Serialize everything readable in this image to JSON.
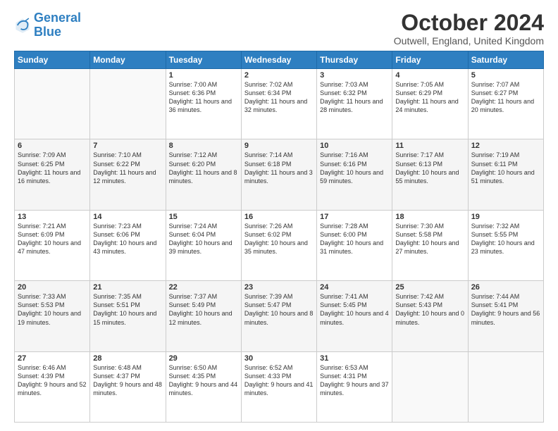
{
  "logo": {
    "line1": "General",
    "line2": "Blue"
  },
  "title": "October 2024",
  "location": "Outwell, England, United Kingdom",
  "days_of_week": [
    "Sunday",
    "Monday",
    "Tuesday",
    "Wednesday",
    "Thursday",
    "Friday",
    "Saturday"
  ],
  "weeks": [
    [
      {
        "day": "",
        "info": ""
      },
      {
        "day": "",
        "info": ""
      },
      {
        "day": "1",
        "info": "Sunrise: 7:00 AM\nSunset: 6:36 PM\nDaylight: 11 hours and 36 minutes."
      },
      {
        "day": "2",
        "info": "Sunrise: 7:02 AM\nSunset: 6:34 PM\nDaylight: 11 hours and 32 minutes."
      },
      {
        "day": "3",
        "info": "Sunrise: 7:03 AM\nSunset: 6:32 PM\nDaylight: 11 hours and 28 minutes."
      },
      {
        "day": "4",
        "info": "Sunrise: 7:05 AM\nSunset: 6:29 PM\nDaylight: 11 hours and 24 minutes."
      },
      {
        "day": "5",
        "info": "Sunrise: 7:07 AM\nSunset: 6:27 PM\nDaylight: 11 hours and 20 minutes."
      }
    ],
    [
      {
        "day": "6",
        "info": "Sunrise: 7:09 AM\nSunset: 6:25 PM\nDaylight: 11 hours and 16 minutes."
      },
      {
        "day": "7",
        "info": "Sunrise: 7:10 AM\nSunset: 6:22 PM\nDaylight: 11 hours and 12 minutes."
      },
      {
        "day": "8",
        "info": "Sunrise: 7:12 AM\nSunset: 6:20 PM\nDaylight: 11 hours and 8 minutes."
      },
      {
        "day": "9",
        "info": "Sunrise: 7:14 AM\nSunset: 6:18 PM\nDaylight: 11 hours and 3 minutes."
      },
      {
        "day": "10",
        "info": "Sunrise: 7:16 AM\nSunset: 6:16 PM\nDaylight: 10 hours and 59 minutes."
      },
      {
        "day": "11",
        "info": "Sunrise: 7:17 AM\nSunset: 6:13 PM\nDaylight: 10 hours and 55 minutes."
      },
      {
        "day": "12",
        "info": "Sunrise: 7:19 AM\nSunset: 6:11 PM\nDaylight: 10 hours and 51 minutes."
      }
    ],
    [
      {
        "day": "13",
        "info": "Sunrise: 7:21 AM\nSunset: 6:09 PM\nDaylight: 10 hours and 47 minutes."
      },
      {
        "day": "14",
        "info": "Sunrise: 7:23 AM\nSunset: 6:06 PM\nDaylight: 10 hours and 43 minutes."
      },
      {
        "day": "15",
        "info": "Sunrise: 7:24 AM\nSunset: 6:04 PM\nDaylight: 10 hours and 39 minutes."
      },
      {
        "day": "16",
        "info": "Sunrise: 7:26 AM\nSunset: 6:02 PM\nDaylight: 10 hours and 35 minutes."
      },
      {
        "day": "17",
        "info": "Sunrise: 7:28 AM\nSunset: 6:00 PM\nDaylight: 10 hours and 31 minutes."
      },
      {
        "day": "18",
        "info": "Sunrise: 7:30 AM\nSunset: 5:58 PM\nDaylight: 10 hours and 27 minutes."
      },
      {
        "day": "19",
        "info": "Sunrise: 7:32 AM\nSunset: 5:55 PM\nDaylight: 10 hours and 23 minutes."
      }
    ],
    [
      {
        "day": "20",
        "info": "Sunrise: 7:33 AM\nSunset: 5:53 PM\nDaylight: 10 hours and 19 minutes."
      },
      {
        "day": "21",
        "info": "Sunrise: 7:35 AM\nSunset: 5:51 PM\nDaylight: 10 hours and 15 minutes."
      },
      {
        "day": "22",
        "info": "Sunrise: 7:37 AM\nSunset: 5:49 PM\nDaylight: 10 hours and 12 minutes."
      },
      {
        "day": "23",
        "info": "Sunrise: 7:39 AM\nSunset: 5:47 PM\nDaylight: 10 hours and 8 minutes."
      },
      {
        "day": "24",
        "info": "Sunrise: 7:41 AM\nSunset: 5:45 PM\nDaylight: 10 hours and 4 minutes."
      },
      {
        "day": "25",
        "info": "Sunrise: 7:42 AM\nSunset: 5:43 PM\nDaylight: 10 hours and 0 minutes."
      },
      {
        "day": "26",
        "info": "Sunrise: 7:44 AM\nSunset: 5:41 PM\nDaylight: 9 hours and 56 minutes."
      }
    ],
    [
      {
        "day": "27",
        "info": "Sunrise: 6:46 AM\nSunset: 4:39 PM\nDaylight: 9 hours and 52 minutes."
      },
      {
        "day": "28",
        "info": "Sunrise: 6:48 AM\nSunset: 4:37 PM\nDaylight: 9 hours and 48 minutes."
      },
      {
        "day": "29",
        "info": "Sunrise: 6:50 AM\nSunset: 4:35 PM\nDaylight: 9 hours and 44 minutes."
      },
      {
        "day": "30",
        "info": "Sunrise: 6:52 AM\nSunset: 4:33 PM\nDaylight: 9 hours and 41 minutes."
      },
      {
        "day": "31",
        "info": "Sunrise: 6:53 AM\nSunset: 4:31 PM\nDaylight: 9 hours and 37 minutes."
      },
      {
        "day": "",
        "info": ""
      },
      {
        "day": "",
        "info": ""
      }
    ]
  ]
}
